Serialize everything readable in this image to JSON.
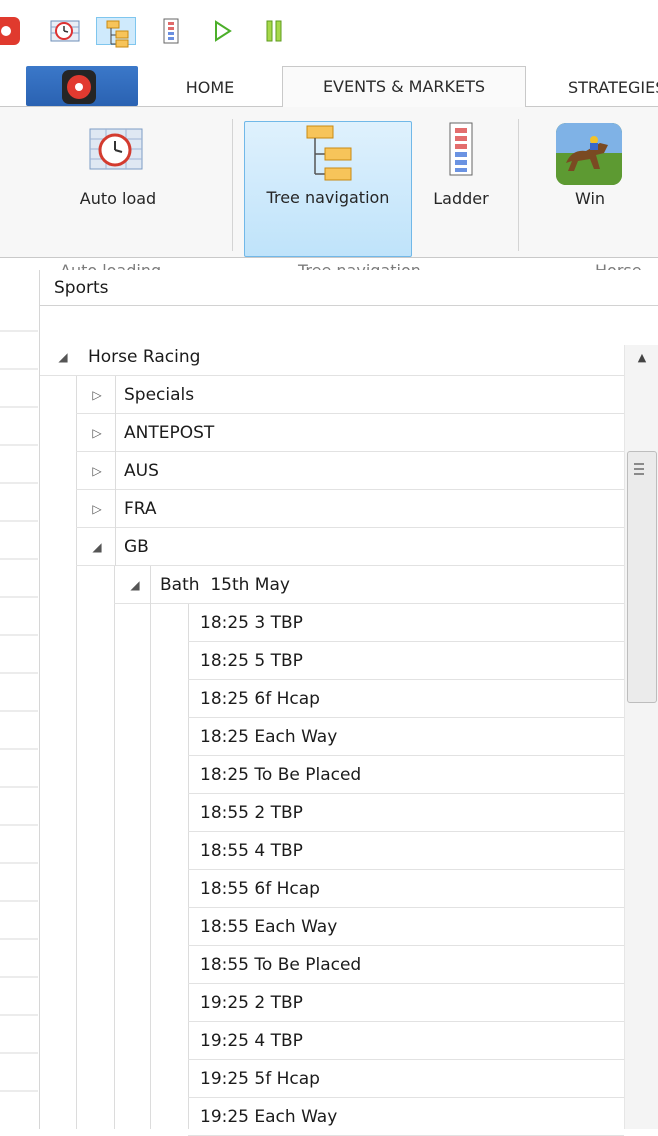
{
  "quick_access": {
    "icons": [
      "app-logo-icon",
      "auto-load-icon",
      "tree-navigation-icon",
      "ladder-icon",
      "play-icon",
      "pause-icon"
    ]
  },
  "ribbon": {
    "tabs": [
      {
        "label": "HOME",
        "active": false
      },
      {
        "label": "EVENTS & MARKETS",
        "active": true
      },
      {
        "label": "STRATEGIES",
        "active": false
      }
    ],
    "buttons": {
      "auto_load": "Auto load",
      "tree_navigation": "Tree navigation",
      "ladder": "Ladder",
      "win": "Win"
    },
    "groups": {
      "auto_loading": "Auto loading",
      "tree_navigation": "Tree navigation",
      "horse": "Horse"
    }
  },
  "tree": {
    "header": "Sports",
    "root": {
      "label": "Horse Racing",
      "expanded": true
    },
    "countries": [
      {
        "label": "Specials",
        "expanded": false
      },
      {
        "label": "ANTEPOST",
        "expanded": false
      },
      {
        "label": "AUS",
        "expanded": false
      },
      {
        "label": "FRA",
        "expanded": false
      },
      {
        "label": "GB",
        "expanded": true
      }
    ],
    "meeting": {
      "label": "Bath  15th May",
      "expanded": true
    },
    "markets": [
      "18:25 3 TBP",
      "18:25 5 TBP",
      "18:25 6f Hcap",
      "18:25 Each Way",
      "18:25 To Be Placed",
      "18:55 2 TBP",
      "18:55 4 TBP",
      "18:55 6f Hcap",
      "18:55 Each Way",
      "18:55 To Be Placed",
      "19:25 2 TBP",
      "19:25 4 TBP",
      "19:25 5f Hcap",
      "19:25 Each Way"
    ]
  },
  "colors": {
    "accent_blue": "#2a62b2",
    "selected_fill": "#cfeafc",
    "selected_border": "#71b8e8",
    "logo_red": "#e23a30"
  }
}
